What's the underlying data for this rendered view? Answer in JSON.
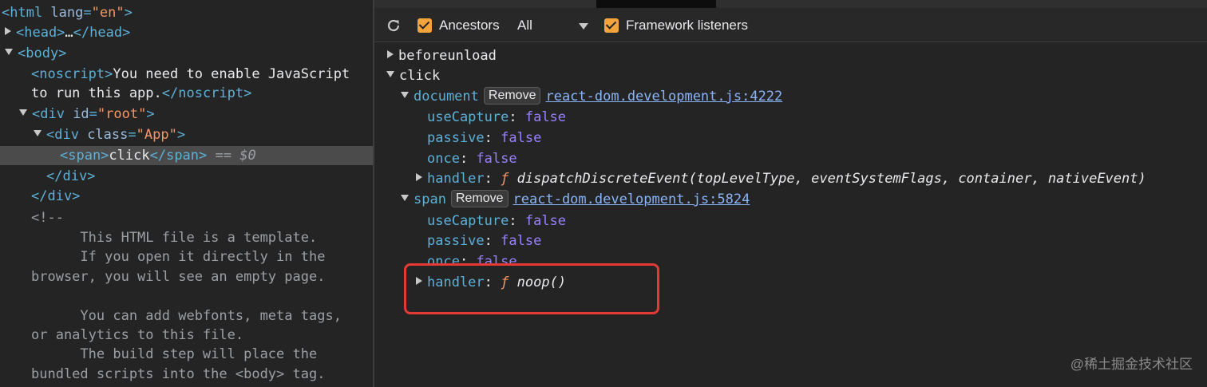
{
  "elements": {
    "l1": {
      "open": "<html ",
      "attr": "lang",
      "eq": "=",
      "val": "\"en\"",
      "close": ">"
    },
    "l2": {
      "open": "<head>",
      "ell": "…",
      "close": "</head>"
    },
    "l3": {
      "open": "<body>"
    },
    "l4": {
      "open": "<noscript>",
      "text": "You need to enable JavaScript"
    },
    "l5": {
      "text": "to run this app.",
      "close": "</noscript>"
    },
    "l6": {
      "open": "<div ",
      "attr": "id",
      "eq": "=",
      "val": "\"root\"",
      "close": ">"
    },
    "l7": {
      "open": "<div ",
      "attr": "class",
      "eq": "=",
      "val": "\"App\"",
      "close": ">"
    },
    "l8": {
      "open": "<span>",
      "text": "click",
      "close": "</span>",
      "marker": " == ",
      "dollar": "$0"
    },
    "l9": {
      "close": "</div>"
    },
    "l10": {
      "close": "</div>"
    },
    "comment": [
      "<!--",
      "      This HTML file is a template.",
      "      If you open it directly in the",
      "browser, you will see an empty page.",
      "",
      "      You can add webfonts, meta tags,",
      "or analytics to this file.",
      "      The build step will place the",
      "bundled scripts into the <body> tag."
    ]
  },
  "toolbar": {
    "ancestors_label": "Ancestors",
    "ancestors_select": "All",
    "framework_label": "Framework listeners"
  },
  "listeners": {
    "beforeunload": "beforeunload",
    "click": "click",
    "document": {
      "label": "document",
      "remove": "Remove",
      "source": "react-dom.development.js:4222",
      "useCapture_key": "useCapture",
      "useCapture_val": "false",
      "passive_key": "passive",
      "passive_val": "false",
      "once_key": "once",
      "once_val": "false",
      "handler_key": "handler",
      "handler_f": "ƒ",
      "handler_sig": "dispatchDiscreteEvent(topLevelType, eventSystemFlags, container, nativeEvent)"
    },
    "span": {
      "label": "span",
      "remove": "Remove",
      "source": "react-dom.development.js:5824",
      "useCapture_key": "useCapture",
      "useCapture_val": "false",
      "passive_key": "passive",
      "passive_val": "false",
      "once_key": "once",
      "once_val": "false",
      "handler_key": "handler",
      "handler_f": "ƒ",
      "handler_sig": "noop()"
    },
    "colon": ": "
  },
  "watermark": "@稀土掘金技术社区",
  "colors": {
    "highlight": "#e53935",
    "checkbox": "#f3a53c"
  }
}
